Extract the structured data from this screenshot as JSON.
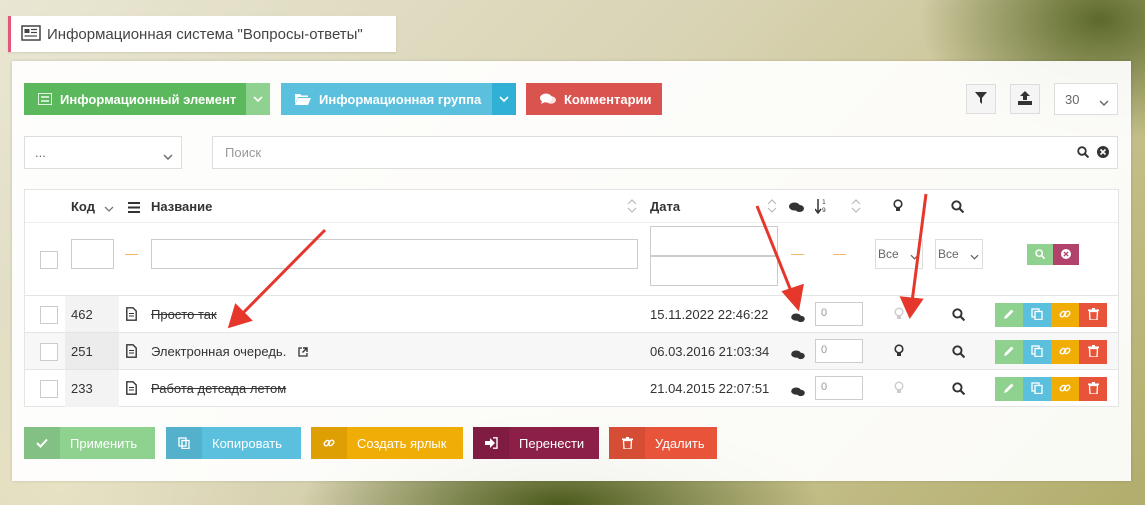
{
  "title": "Информационная система \"Вопросы-ответы\"",
  "toolbar": {
    "info_element": "Информационный элемент",
    "info_group": "Информационная группа",
    "comments": "Комментарии",
    "per_page": "30"
  },
  "filters": {
    "group_select": "...",
    "search_placeholder": "Поиск"
  },
  "table": {
    "columns": {
      "code": "Код",
      "name": "Название",
      "date": "Дата"
    },
    "filter_select_all": "Все",
    "dash": "—",
    "rows": [
      {
        "code": "462",
        "name": "Просто так",
        "date": "15.11.2022 22:46:22",
        "sorting": "0"
      },
      {
        "code": "251",
        "name": "Электронная очередь.",
        "date": "06.03.2016 21:03:34",
        "sorting": "0"
      },
      {
        "code": "233",
        "name": "Работа детсада летом",
        "date": "21.04.2015 22:07:51",
        "sorting": "0"
      }
    ]
  },
  "bottom": {
    "apply": "Применить",
    "copy": "Копировать",
    "shortcut": "Создать ярлык",
    "move": "Перенести",
    "delete": "Удалить"
  },
  "colors": {
    "green": "#5cb85c",
    "blue": "#5bc0de",
    "red": "#d9534f",
    "yellow": "#f0ad05",
    "maroon": "#8b1f48",
    "orange_red": "#e8543a"
  }
}
